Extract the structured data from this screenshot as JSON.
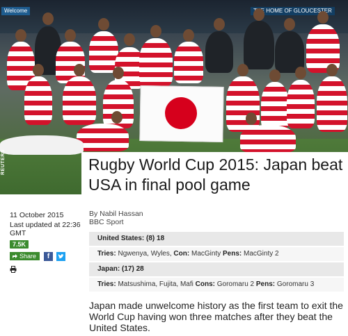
{
  "hero": {
    "photo_credit": "REUTERS",
    "title": "Rugby World Cup 2015: Japan beat USA in final pool game",
    "stadium_banners": [
      "Welcome",
      "THE HOME OF GLOUCESTER"
    ]
  },
  "meta": {
    "date": "11 October 2015",
    "updated": "Last updated at 22:36 GMT",
    "share_count": "7.5K",
    "share_label": "Share",
    "author": "By Nabil Hassan",
    "source": "BBC Sport"
  },
  "score_table": {
    "usa_team": "United States:",
    "usa_score": "(8) 18",
    "usa_tries_label": "Tries:",
    "usa_tries": "Ngwenya, Wyles",
    "usa_con_label": "Con:",
    "usa_con": "MacGinty",
    "usa_pens_label": "Pens:",
    "usa_pens": "MacGinty 2",
    "japan_team": "Japan:",
    "japan_score": "(17) 28",
    "japan_tries_label": "Tries:",
    "japan_tries": "Matsushima, Fujita, Mafi",
    "japan_cons_label": "Cons:",
    "japan_cons": "Goromaru 2",
    "japan_pens_label": "Pens:",
    "japan_pens": "Goromaru 3"
  },
  "lead": "Japan made unwelcome history as the first team to exit the World Cup having won three matches after they beat the United States."
}
